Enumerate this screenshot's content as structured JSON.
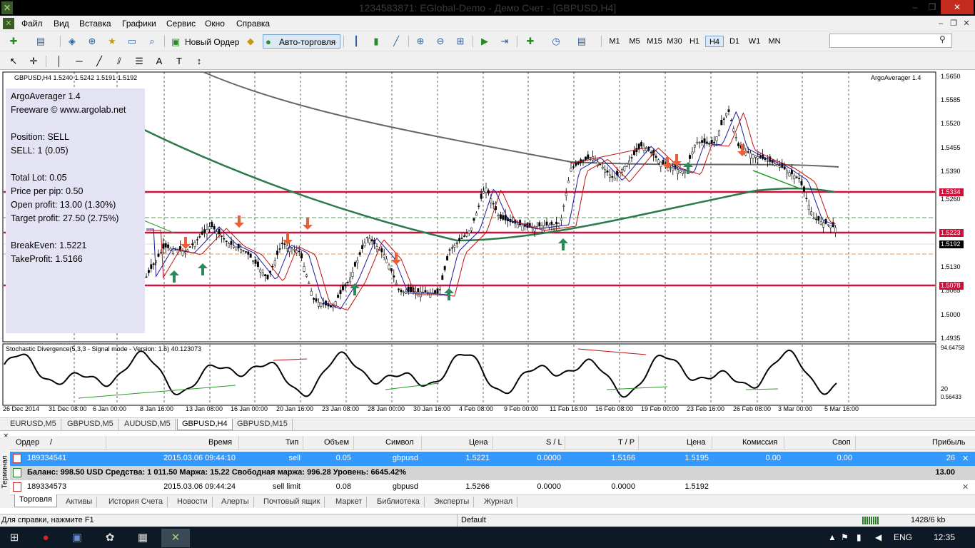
{
  "window": {
    "title": "1234583871: EGlobal-Demo - Демо Счет - [GBPUSD,H4]"
  },
  "menu": [
    "Файл",
    "Вид",
    "Вставка",
    "Графики",
    "Сервис",
    "Окно",
    "Справка"
  ],
  "toolbar": {
    "new_order": "Новый Ордер",
    "autotrading": "Авто-торговля",
    "timeframes": [
      "M1",
      "M5",
      "M15",
      "M30",
      "H1",
      "H4",
      "D1",
      "W1",
      "MN"
    ],
    "active_timeframe": "H4"
  },
  "chart": {
    "header": "GBPUSD,H4  1.5240 1.5242 1.5191 1.5192",
    "indicator_name": "ArgoAverager 1.4",
    "subwindow_header": "Stochastic Divergence(5,3,3 - Signal mode - Version: 1.6) 40.123073",
    "sub_levels": [
      "94.64758",
      "20",
      "0.56433"
    ],
    "info_panel": [
      "ArgoAverager 1.4",
      "Freeware © www.argolab.net",
      "",
      "Position: SELL",
      "SELL: 1 (0.05)",
      "",
      "Total Lot: 0.05",
      "Price per pip: 0.50",
      "Open profit: 13.00 (1.30%)",
      "Target profit: 27.50 (2.75%)",
      "",
      "BreakEven: 1.5221",
      "TakeProfit: 1.5166"
    ],
    "price_labels": [
      "1.5650",
      "1.5585",
      "1.5520",
      "1.5455",
      "1.5390",
      "1.5260",
      "1.5130",
      "1.5065",
      "1.5000",
      "1.4935"
    ],
    "marked_prices": [
      {
        "label": "1.5334",
        "color": "#d0103a"
      },
      {
        "label": "1.5223",
        "color": "#d0103a"
      },
      {
        "label": "1.5192",
        "color": "#000000"
      },
      {
        "label": "1.5078",
        "color": "#d0103a"
      }
    ],
    "time_labels": [
      "26 Dec 2014",
      "31 Dec 08:00",
      "6 Jan 00:00",
      "8 Jan 16:00",
      "13 Jan 08:00",
      "16 Jan 00:00",
      "20 Jan 16:00",
      "23 Jan 08:00",
      "28 Jan 00:00",
      "30 Jan 16:00",
      "4 Feb 08:00",
      "9 Feb 00:00",
      "11 Feb 16:00",
      "16 Feb 08:00",
      "19 Feb 00:00",
      "23 Feb 16:00",
      "26 Feb 08:00",
      "3 Mar 00:00",
      "5 Mar 16:00"
    ]
  },
  "chart_tabs": [
    "EURUSD,M5",
    "GBPUSD,M5",
    "AUDUSD,M5",
    "GBPUSD,H4",
    "GBPUSD,M15"
  ],
  "active_chart_tab": "GBPUSD,H4",
  "terminal": {
    "side_label": "Терминал",
    "columns": [
      "Ордер",
      "/",
      "Время",
      "Тип",
      "Объем",
      "Символ",
      "Цена",
      "S / L",
      "T / P",
      "Цена",
      "Комиссия",
      "Своп",
      "Прибыль"
    ],
    "orders": [
      {
        "order": "189334541",
        "time": "2015.03.06 09:44:10",
        "type": "sell",
        "volume": "0.05",
        "symbol": "gbpusd",
        "price": "1.5221",
        "sl": "0.0000",
        "tp": "1.5166",
        "cur": "1.5195",
        "commission": "0.00",
        "swap": "0.00",
        "profit": "26"
      },
      {
        "order": "189334573",
        "time": "2015.03.06 09:44:24",
        "type": "sell limit",
        "volume": "0.08",
        "symbol": "gbpusd",
        "price": "1.5266",
        "sl": "0.0000",
        "tp": "0.0000",
        "cur": "1.5192",
        "commission": "",
        "swap": "",
        "profit": ""
      }
    ],
    "balance_line": "Баланс: 998.50 USD  Средства: 1 011.50  Маржа: 15.22  Свободная маржа: 996.28  Уровень: 6645.42%",
    "balance_profit": "13.00",
    "tabs": [
      "Торговля",
      "Активы",
      "История Счета",
      "Новости",
      "Алерты",
      "Почтовый ящик",
      "Маркет",
      "Библиотека",
      "Эксперты",
      "Журнал"
    ],
    "active_tab": "Торговля"
  },
  "status": {
    "help": "Для справки, нажмите F1",
    "profile": "Default",
    "traffic": "1428/6 kb"
  },
  "taskbar": {
    "lang": "ENG",
    "time": "12:35"
  },
  "colors": {
    "level_red": "#d0103a",
    "selected_row": "#3399ff",
    "info_panel_bg": "#e3e3f4"
  }
}
